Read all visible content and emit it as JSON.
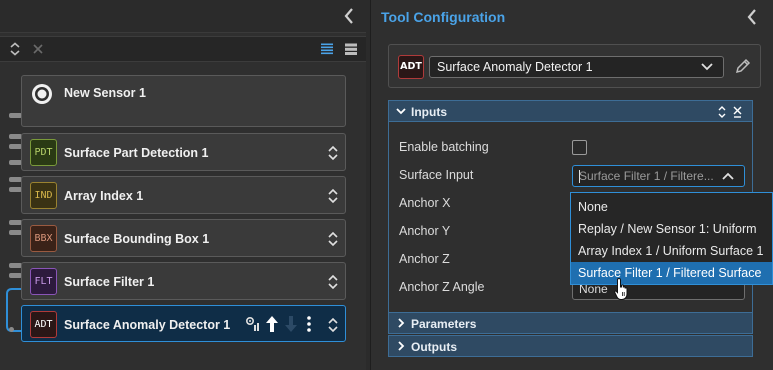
{
  "pipeline": {
    "nodes": [
      {
        "badge": "",
        "name": "New Sensor 1",
        "badge_bg": "#f0f0f0",
        "badge_color": "#2f2f2f"
      },
      {
        "badge": "PDT",
        "name": "Surface Part Detection 1",
        "badge_bg": "#2a3a14",
        "badge_color": "#b7d26a"
      },
      {
        "badge": "IND",
        "name": "Array Index 1",
        "badge_bg": "#3a3214",
        "badge_color": "#d6b54a"
      },
      {
        "badge": "BBX",
        "name": "Surface Bounding Box 1",
        "badge_bg": "#3a2218",
        "badge_color": "#d8957a"
      },
      {
        "badge": "FLT",
        "name": "Surface Filter 1",
        "badge_bg": "#2d1a3d",
        "badge_color": "#c99ae8"
      },
      {
        "badge": "ADT",
        "name": "Surface Anomaly Detector 1",
        "badge_bg": "#2a1717",
        "badge_color": "#ffffff"
      }
    ],
    "selected_index": 5
  },
  "tool_config": {
    "title": "Tool Configuration",
    "tool_badge": "ADT",
    "tool_name": "Surface Anomaly Detector 1",
    "sections": {
      "inputs": "Inputs",
      "parameters": "Parameters",
      "outputs": "Outputs"
    },
    "fields": {
      "enable_batching": "Enable batching",
      "surface_input": "Surface Input",
      "anchor_x": "Anchor X",
      "anchor_y": "Anchor Y",
      "anchor_z": "Anchor Z",
      "anchor_z_angle": "Anchor Z Angle"
    },
    "surface_input_value": "Surface Filter 1 / Filtere...",
    "anchor_z_angle_value": "None",
    "dropdown_options": [
      "None",
      "Replay / New Sensor 1: Uniform",
      "Array Index 1 / Uniform Surface 1",
      "Surface Filter 1 / Filtered Surface"
    ],
    "hovered_option": 3
  },
  "colors": {
    "accent": "#2f8fd8",
    "title_blue": "#4aa3e8",
    "section_bg": "#2f4a63"
  }
}
